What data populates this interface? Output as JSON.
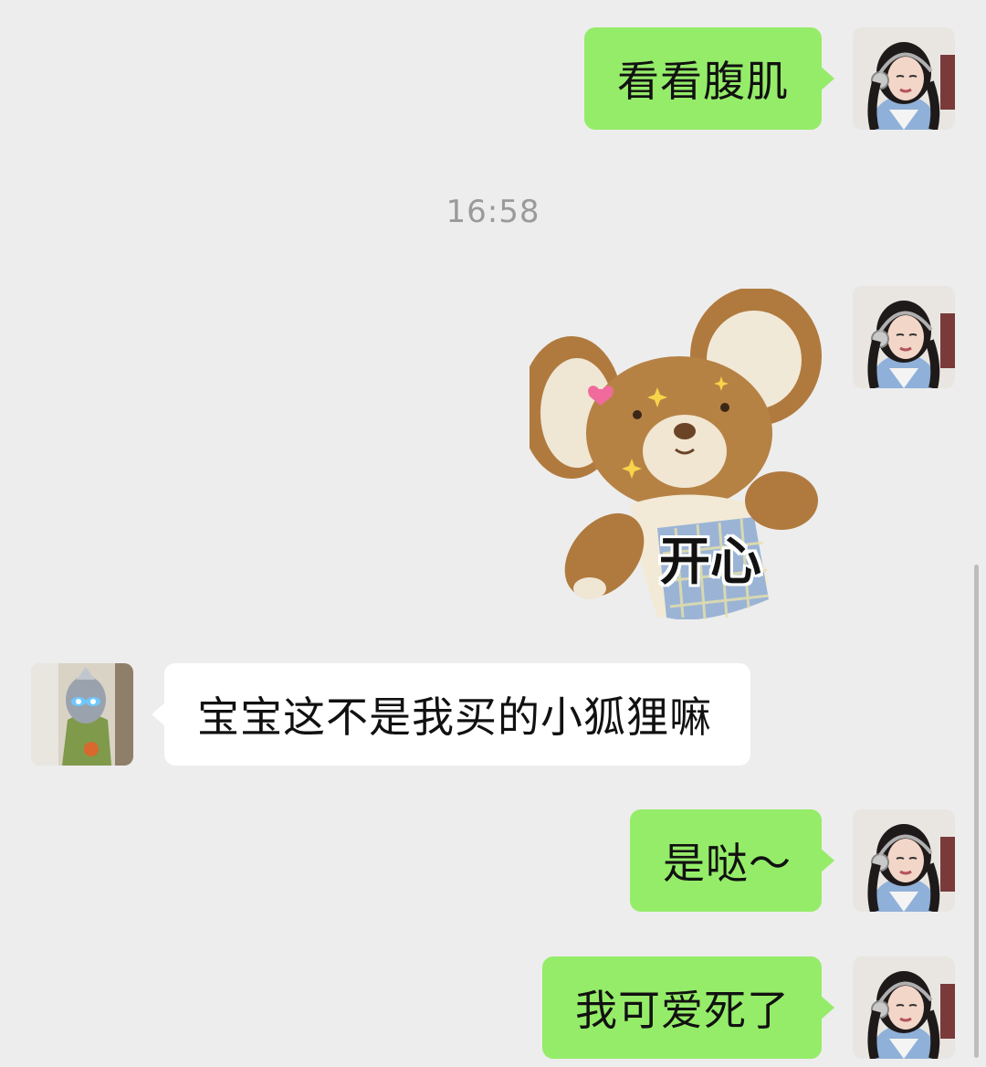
{
  "timestamp": "16:58",
  "messages": [
    {
      "sender": "me",
      "type": "text",
      "text": "看看腹肌"
    },
    {
      "sender": "me",
      "type": "sticker",
      "caption": "开心"
    },
    {
      "sender": "other",
      "type": "text",
      "text": "宝宝这不是我买的小狐狸嘛"
    },
    {
      "sender": "me",
      "type": "text",
      "text": "是哒～"
    },
    {
      "sender": "me",
      "type": "text",
      "text": "我可爱死了"
    }
  ],
  "icons": {
    "my_avatar": "girl-with-headphones-avatar",
    "other_avatar": "figure-with-glowing-eyes-avatar",
    "sticker": "plush-mouse-sticker"
  },
  "colors": {
    "background": "#ededed",
    "my_bubble": "#95ec69",
    "other_bubble": "#ffffff",
    "timestamp_text": "#9a9a9a"
  }
}
